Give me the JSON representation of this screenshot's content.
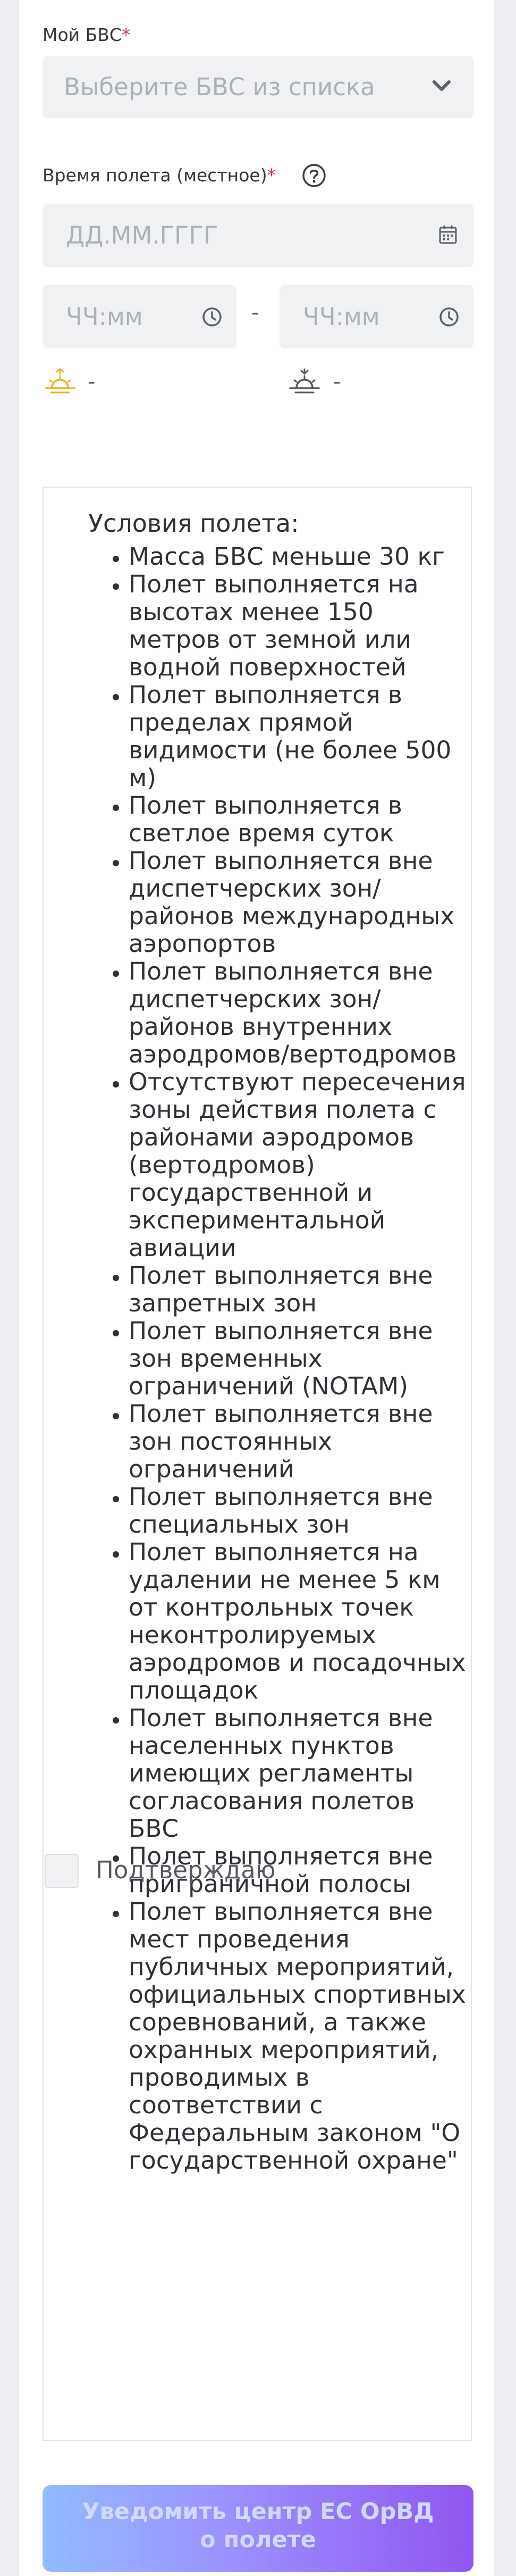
{
  "form": {
    "drone_label": "Мой БВС",
    "required_mark": "*",
    "drone_select_placeholder": "Выберите БВС из списка",
    "flight_time_label": "Время полета (местное)",
    "date_placeholder": "ДД.ММ.ГГГГ",
    "time_start_placeholder": "ЧЧ:мм",
    "time_separator": "-",
    "time_end_placeholder": "ЧЧ:мм",
    "sunrise_value": "-",
    "sunset_value": "-"
  },
  "conditions": {
    "title": "Условия полета:",
    "items": [
      "Масса БВС меньше 30 кг",
      "Полет выполняется на высотах менее 150 метров от земной или водной поверхностей",
      "Полет выполняется в пределах прямой видимости (не более 500 м)",
      "Полет выполняется в светлое время суток",
      "Полет выполняется вне диспетчерских зон/районов международных аэропортов",
      "Полет выполняется вне диспетчерских зон/районов внутренних аэродромов/вертодромов",
      "Отсутствуют пересечения зоны действия полета с районами аэродромов (вертодромов) государственной и экспериментальной авиации",
      "Полет выполняется вне запретных зон",
      "Полет выполняется вне зон временных ограничений (NOTAM)",
      "Полет выполняется вне зон постоянных ограничений",
      "Полет выполняется вне специальных зон",
      "Полет выполняется на удалении не менее 5 км от контрольных точек неконтролируемых аэродромов и посадочных площадок",
      "Полет выполняется вне населенных пунктов имеющих регламенты согласования полетов БВС",
      "Полет выполняется вне приграничной полосы",
      "Полет выполняется вне мест проведения публичных мероприятий, официальных спортивных соревнований, а также охранных мероприятий, проводимых в соответствии с Федеральным законом \"О государственной охране\""
    ],
    "confirm_label": "Подтверждаю",
    "confirm_checked": false
  },
  "submit": {
    "label": "Уведомить центр ЕС ОрВД о полете"
  },
  "colors": {
    "required": "#d2314c",
    "sunrise_icon": "#f2b01e",
    "field_background": "#f0f1f3",
    "button_gradient_start": "#7fb0ff",
    "button_gradient_end": "#7c3aed"
  },
  "icons": {
    "drone_select": "chevron-down-icon",
    "help": "question-circle-icon",
    "date": "calendar-icon",
    "time": "clock-icon",
    "sunrise": "sunrise-icon",
    "sunset": "sunset-icon"
  }
}
